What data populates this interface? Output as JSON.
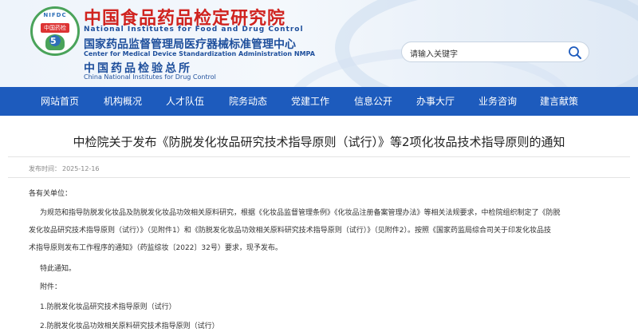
{
  "header": {
    "logo_text": "NIFDC",
    "logo_badge": "中国药检",
    "logo_num": "5",
    "title_cn": "中国食品药品检定研究院",
    "title_en": "National Institutes for Food and Drug Control",
    "sub1_cn": "国家药品监督管理局医疗器械标准管理中心",
    "sub1_en": "Center for Medical Device Standardization Administration NMPA",
    "sub2_cn": "中国药品检验总所",
    "sub2_en": "China National Institutes for Drug Control"
  },
  "search": {
    "placeholder": "请输入关键字"
  },
  "nav": {
    "items": [
      "网站首页",
      "机构概况",
      "人才队伍",
      "院务动态",
      "党建工作",
      "信息公开",
      "办事大厅",
      "业务咨询",
      "建言献策"
    ]
  },
  "article": {
    "title": "中检院关于发布《防脱发化妆品研究技术指导原则（试行）》等2项化妆品技术指导原则的通知",
    "date_label": "发布时间：",
    "date": "2025-12-16",
    "greeting": "各有关单位：",
    "para1_line1": "为规范和指导防脱发化妆品及防脱发化妆品功效相关原料研究，根据《化妆品监督管理条例》《化妆品注册备案管理办法》等相关法规要求，中检院组织制定了《防脱",
    "para1_line2": "发化妆品研究技术指导原则（试行）》（见附件1）和《防脱发化妆品功效相关原料研究技术指导原则（试行）》（见附件2）。按照《国家药监局综合司关于印发化妆品技",
    "para1_line3": "术指导原则发布工作程序的通知》（药监综妆〔2022〕32号）要求，现予发布。",
    "notice": "特此通知。",
    "attachments_label": "附件：",
    "attachment1": "1.防脱发化妆品研究技术指导原则（试行）",
    "attachment2": "2.防脱发化妆品功效相关原料研究技术指导原则（试行）"
  }
}
